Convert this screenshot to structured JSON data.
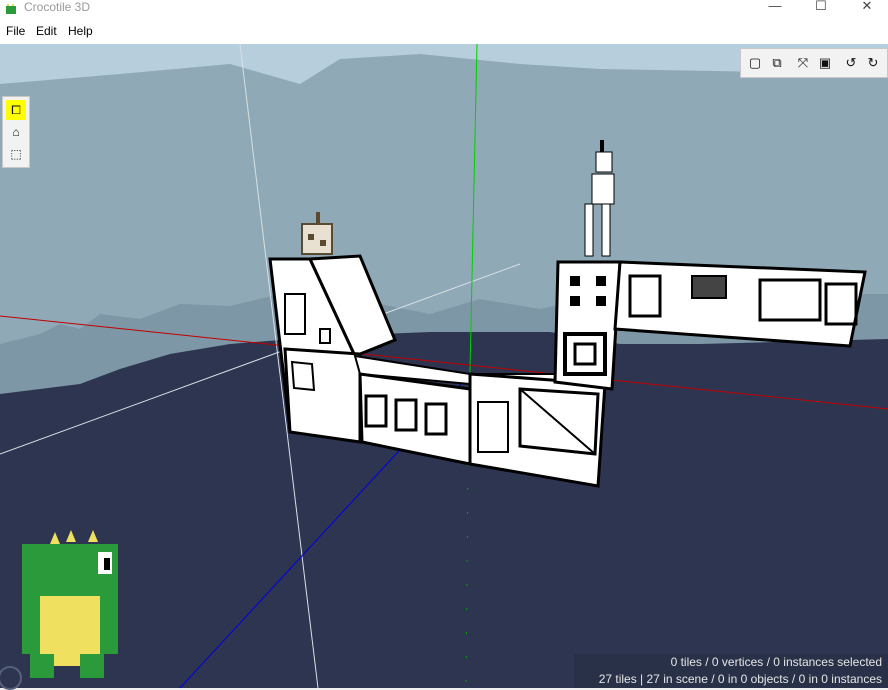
{
  "window": {
    "title": "Crocotile 3D",
    "minimize": "—",
    "maximize": "☐",
    "close": "✕"
  },
  "menu": [
    "File",
    "Edit",
    "Help"
  ],
  "toolbar_right": {
    "buttons": [
      {
        "name": "view-flat-icon",
        "glyph": "▢"
      },
      {
        "name": "view-box-icon",
        "glyph": "⧉"
      },
      {
        "name": "axis-gizmo-icon",
        "glyph": "⤧"
      },
      {
        "name": "fill-square-icon",
        "glyph": "▣"
      },
      {
        "name": "rotate-left-icon",
        "glyph": "↺"
      },
      {
        "name": "rotate-right-icon",
        "glyph": "↻"
      }
    ]
  },
  "toolbar_left": {
    "buttons": [
      {
        "name": "draw-tile-icon",
        "glyph": "⧠",
        "active": true
      },
      {
        "name": "edit-face-icon",
        "glyph": "⌂",
        "active": false
      },
      {
        "name": "cube-icon",
        "glyph": "⬚",
        "active": false
      }
    ]
  },
  "status": {
    "selected": "0 tiles / 0 vertices / 0 instances selected",
    "scene": "27 tiles | 27 in scene / 0 in 0 objects / 0 in 0 instances"
  },
  "colors": {
    "sky": "#8fa9b6",
    "ground": "#2e3550",
    "accent_yellow": "#ffff00",
    "axis_green": "#00d000",
    "axis_red": "#c00000",
    "axis_blue": "#0000e0"
  }
}
